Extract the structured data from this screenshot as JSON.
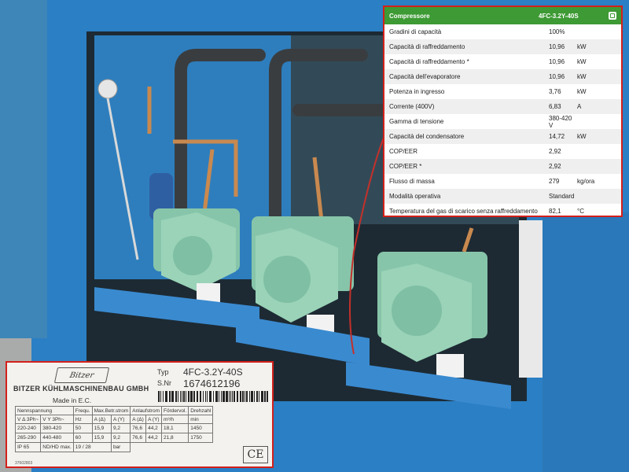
{
  "photo": {
    "description_colors": {
      "cabinet": "#2b7fc4",
      "compressor": "#87c5aa",
      "pipe": "#3a3d40"
    }
  },
  "spec_table": {
    "header_left": "Compressore",
    "header_right": "4FC-3.2Y-40S",
    "rows": [
      {
        "label": "Gradini di capacità",
        "value": "100%",
        "unit": ""
      },
      {
        "label": "Capacità di raffreddamento",
        "value": "10,96",
        "unit": "kW"
      },
      {
        "label": "Capacità di raffreddamento *",
        "value": "10,96",
        "unit": "kW"
      },
      {
        "label": "Capacità dell'evaporatore",
        "value": "10,96",
        "unit": "kW"
      },
      {
        "label": "Potenza in ingresso",
        "value": "3,76",
        "unit": "kW"
      },
      {
        "label": "Corrente (400V)",
        "value": "6,83",
        "unit": "A"
      },
      {
        "label": "Gamma di tensione",
        "value": "380-420 V",
        "unit": ""
      },
      {
        "label": "Capacità del condensatore",
        "value": "14,72",
        "unit": "kW"
      },
      {
        "label": "COP/EER",
        "value": "2,92",
        "unit": ""
      },
      {
        "label": "COP/EER *",
        "value": "2,92",
        "unit": ""
      },
      {
        "label": "Flusso di massa",
        "value": "279",
        "unit": "kg/ora"
      },
      {
        "label": "Modalità operativa",
        "value": "Standard",
        "unit": ""
      },
      {
        "label": "Temperatura del gas di scarico senza raffreddamento",
        "value": "82,1",
        "unit": "°C"
      }
    ]
  },
  "nameplate": {
    "logo": "Bitzer",
    "maker": "BITZER KÜHLMASCHINENBAU GMBH",
    "made_in": "Made in E.C.",
    "typ_label": "Typ",
    "typ_value": "4FC-3.2Y-40S",
    "snr_label": "S.Nr",
    "snr_value": "1674612196",
    "headers1": [
      "Nennspannung",
      "Frequ.",
      "Max.Betr.strom",
      "Anlaufstrom",
      "Fördervol.",
      "Drehzahl"
    ],
    "headers2": [
      "V Δ 3Ph~",
      "V Y 3Ph~",
      "Hz",
      "A (Δ)",
      "A (Y)",
      "A (Δ)",
      "A (Y)",
      "m³/h",
      "min"
    ],
    "rows": [
      [
        "220-240",
        "380-420",
        "50",
        "15,9",
        "9,2",
        "76,6",
        "44,2",
        "18,1",
        "1450"
      ],
      [
        "265-290",
        "440-480",
        "60",
        "15,9",
        "9,2",
        "76,6",
        "44,2",
        "21,8",
        "1750"
      ]
    ],
    "ip_label": "IP 65",
    "pressure_label": "ND/HD max.",
    "pressure_values": "19 / 28",
    "pressure_unit": "bar",
    "ce": "CE",
    "small_code": "37602803"
  }
}
